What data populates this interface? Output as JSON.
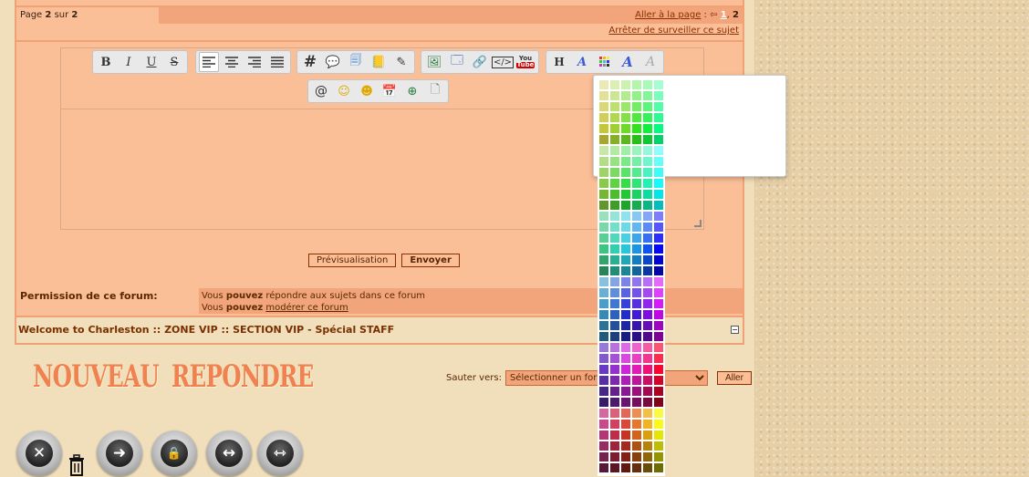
{
  "pagination": {
    "page_label": "Page",
    "page_current": "2",
    "page_sep": "sur",
    "page_total": "2",
    "goto_label": "Aller à la page",
    "goto_colon": ":",
    "page_link_1": "1",
    "page_sep_comma": ",",
    "page_link_2": "2",
    "stop_watch": "Arrêter de surveiller ce sujet"
  },
  "toolbar": {
    "groups": [
      [
        "B",
        "I",
        "U",
        "S"
      ],
      [
        "align-left",
        "align-center",
        "align-right",
        "align-justify"
      ],
      [
        "#",
        "quote",
        "code",
        "spoiler",
        "hide"
      ],
      [
        "image",
        "host-image",
        "link",
        "embed",
        "youtube"
      ],
      [
        "H",
        "font-size",
        "color-palette",
        "font-face",
        "clear-format"
      ],
      [
        "@",
        "smiley",
        "emoji",
        "date",
        "other"
      ]
    ],
    "labels": {
      "bold": "B",
      "italic": "I",
      "underline": "U",
      "strike": "S",
      "hash": "#",
      "heading": "H",
      "at": "@",
      "youtube_top": "You",
      "youtube_bottom": "Tube"
    }
  },
  "buttons": {
    "preview": "Prévisualisation",
    "send": "Envoyer"
  },
  "permission": {
    "label": "Permission de ce forum:",
    "line1_prefix": "Vous",
    "line1_bold": "pouvez",
    "line1_suffix": "répondre aux sujets dans ce forum",
    "line2_prefix": "Vous",
    "line2_bold": "pouvez",
    "line2_link": "modérer ce forum"
  },
  "breadcrumb": "Welcome to Charleston :: ZONE VIP :: SECTION VIP - Spécial STAFF",
  "breadcrumb_toggle": "−",
  "actions": {
    "new_topic": "NOUVEAU",
    "reply": "REPONDRE"
  },
  "jump": {
    "label": "Sauter vers:",
    "selected": "Sélectionner un forum",
    "go": "Aller"
  },
  "mod_icons": [
    "delete-topic",
    "trash",
    "move-topic",
    "lock-topic",
    "split-topic",
    "merge-topic"
  ],
  "colors": {
    "panel": "#fbbf98",
    "panel_dark": "#f2a57b",
    "border": "#f0a276",
    "text_dark": "#5a2800",
    "big_button": "#ef8250"
  }
}
